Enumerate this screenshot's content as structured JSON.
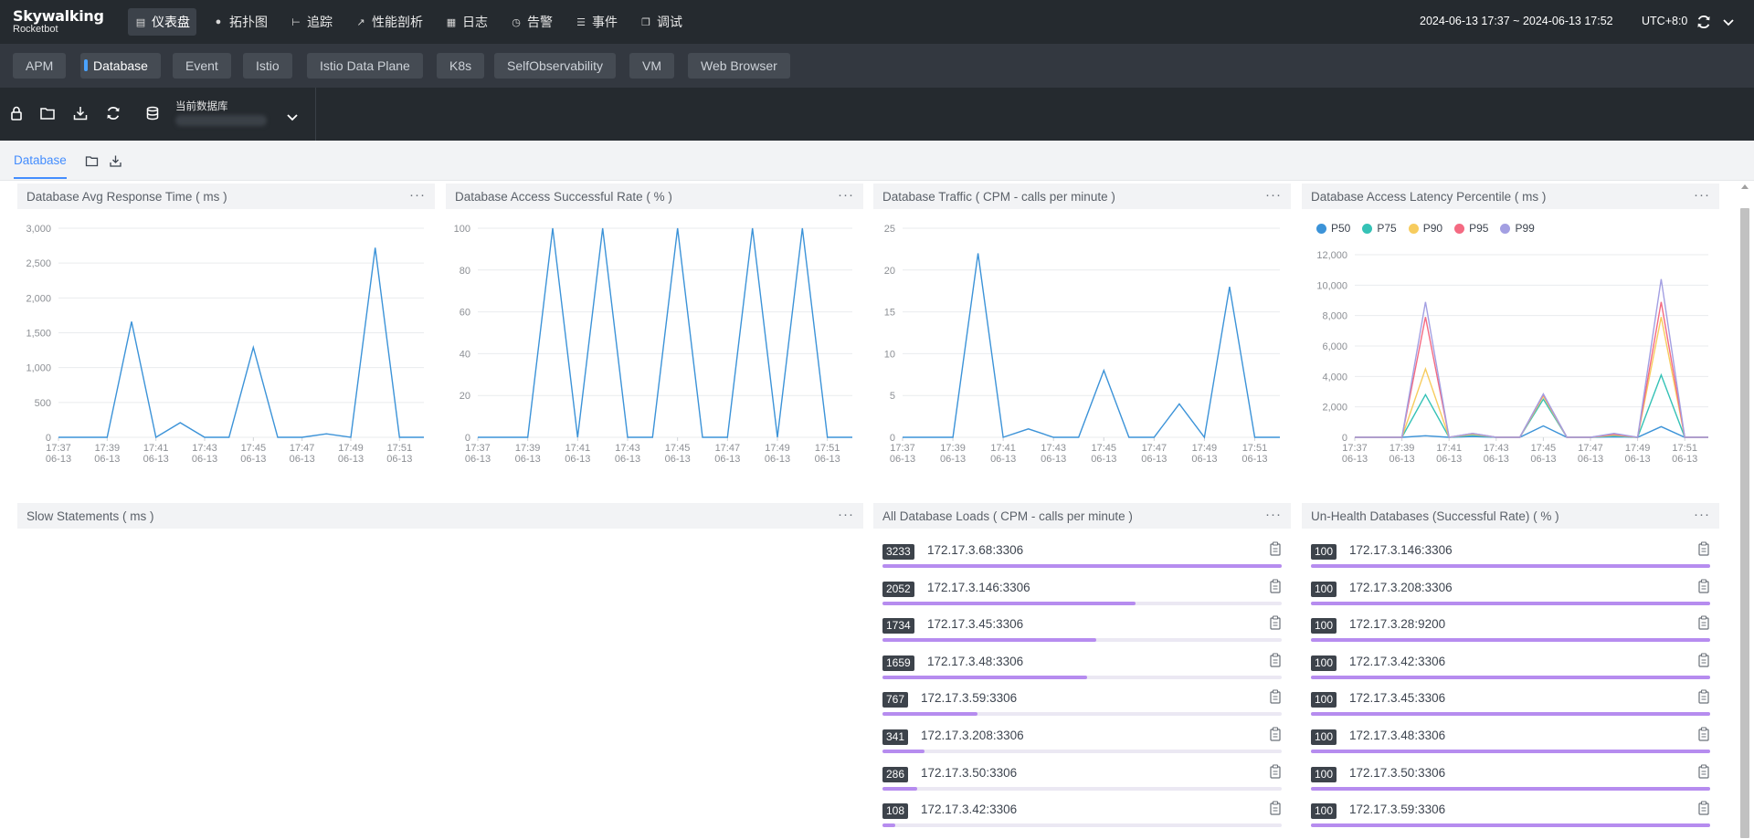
{
  "brand": {
    "name": "Skywalking",
    "sub": "Rocketbot"
  },
  "nav": {
    "items": [
      {
        "icon": "dashboard-icon",
        "label": "仪表盘",
        "active": true
      },
      {
        "icon": "topology-icon",
        "label": "拓扑图",
        "active": false
      },
      {
        "icon": "trace-icon",
        "label": "追踪",
        "active": false
      },
      {
        "icon": "profile-icon",
        "label": "性能剖析",
        "active": false
      },
      {
        "icon": "log-icon",
        "label": "日志",
        "active": false
      },
      {
        "icon": "alarm-icon",
        "label": "告警",
        "active": false
      },
      {
        "icon": "event-icon",
        "label": "事件",
        "active": false
      },
      {
        "icon": "debug-icon",
        "label": "调试",
        "active": false
      }
    ],
    "time_range": "2024-06-13 17:37 ~ 2024-06-13 17:52",
    "timezone": "UTC+8:0"
  },
  "layers": [
    "APM",
    "Database",
    "Event",
    "Istio",
    "Istio Data Plane",
    "K8s",
    "SelfObservability",
    "VM",
    "Web Browser"
  ],
  "active_layer": "Database",
  "toolbar": {
    "selector_label": "当前数据库"
  },
  "dashboard_tab": {
    "label": "Database"
  },
  "x_ticks": [
    [
      "17:37",
      "06-13"
    ],
    [
      "17:39",
      "06-13"
    ],
    [
      "17:41",
      "06-13"
    ],
    [
      "17:43",
      "06-13"
    ],
    [
      "17:45",
      "06-13"
    ],
    [
      "17:47",
      "06-13"
    ],
    [
      "17:49",
      "06-13"
    ],
    [
      "17:51",
      "06-13"
    ]
  ],
  "widgets": {
    "avg_response": {
      "title": "Database Avg Response Time ( ms )"
    },
    "success_rate": {
      "title": "Database Access Successful Rate ( % )"
    },
    "traffic": {
      "title": "Database Traffic ( CPM - calls per minute )"
    },
    "latency": {
      "title": "Database Access Latency Percentile ( ms )"
    },
    "slow_statements": {
      "title": "Slow Statements ( ms )"
    },
    "all_loads": {
      "title": "All Database Loads ( CPM - calls per minute )"
    },
    "unhealthy": {
      "title": "Un-Health Databases (Successful Rate) ( % )"
    }
  },
  "chart_data": [
    {
      "type": "line",
      "title": "Database Avg Response Time ( ms )",
      "x": [
        "17:37",
        "17:38",
        "17:39",
        "17:40",
        "17:41",
        "17:42",
        "17:43",
        "17:44",
        "17:45",
        "17:46",
        "17:47",
        "17:48",
        "17:49",
        "17:50",
        "17:51",
        "17:52"
      ],
      "series": [
        {
          "values": [
            0,
            0,
            0,
            1660,
            0,
            210,
            0,
            0,
            1290,
            0,
            0,
            50,
            0,
            2720,
            0,
            0
          ]
        }
      ],
      "ylim": [
        0,
        3000
      ],
      "yticks": [
        "0",
        "500",
        "1,000",
        "1,500",
        "2,000",
        "2,500",
        "3,000"
      ],
      "color": "#3c93d8"
    },
    {
      "type": "line",
      "title": "Database Access Successful Rate ( % )",
      "x": [
        "17:37",
        "17:38",
        "17:39",
        "17:40",
        "17:41",
        "17:42",
        "17:43",
        "17:44",
        "17:45",
        "17:46",
        "17:47",
        "17:48",
        "17:49",
        "17:50",
        "17:51",
        "17:52"
      ],
      "series": [
        {
          "values": [
            0,
            0,
            0,
            100,
            0,
            100,
            0,
            0,
            100,
            0,
            0,
            100,
            0,
            100,
            0,
            0
          ]
        }
      ],
      "ylim": [
        0,
        100
      ],
      "yticks": [
        "0",
        "20",
        "40",
        "60",
        "80",
        "100"
      ],
      "color": "#3c93d8"
    },
    {
      "type": "line",
      "title": "Database Traffic ( CPM - calls per minute )",
      "x": [
        "17:37",
        "17:38",
        "17:39",
        "17:40",
        "17:41",
        "17:42",
        "17:43",
        "17:44",
        "17:45",
        "17:46",
        "17:47",
        "17:48",
        "17:49",
        "17:50",
        "17:51",
        "17:52"
      ],
      "series": [
        {
          "values": [
            0,
            0,
            0,
            22,
            0,
            1,
            0,
            0,
            8,
            0,
            0,
            4,
            0,
            18,
            0,
            0
          ]
        }
      ],
      "ylim": [
        0,
        25
      ],
      "yticks": [
        "0",
        "5",
        "10",
        "15",
        "20",
        "25"
      ],
      "color": "#3c93d8"
    },
    {
      "type": "line",
      "title": "Database Access Latency Percentile ( ms )",
      "x": [
        "17:37",
        "17:38",
        "17:39",
        "17:40",
        "17:41",
        "17:42",
        "17:43",
        "17:44",
        "17:45",
        "17:46",
        "17:47",
        "17:48",
        "17:49",
        "17:50",
        "17:51",
        "17:52"
      ],
      "series": [
        {
          "name": "P50",
          "color": "#3c93d8",
          "values": [
            0,
            0,
            0,
            100,
            0,
            50,
            0,
            0,
            750,
            0,
            0,
            30,
            0,
            700,
            0,
            0
          ]
        },
        {
          "name": "P75",
          "color": "#35c2b6",
          "values": [
            0,
            0,
            0,
            2800,
            0,
            150,
            0,
            0,
            2500,
            0,
            0,
            100,
            0,
            4100,
            0,
            0
          ]
        },
        {
          "name": "P90",
          "color": "#f7cc5e",
          "values": [
            0,
            0,
            0,
            4500,
            0,
            200,
            0,
            0,
            2700,
            0,
            0,
            150,
            0,
            7900,
            0,
            0
          ]
        },
        {
          "name": "P95",
          "color": "#f46a82",
          "values": [
            0,
            0,
            0,
            7900,
            0,
            250,
            0,
            0,
            2800,
            0,
            0,
            200,
            0,
            8900,
            0,
            0
          ]
        },
        {
          "name": "P99",
          "color": "#a39fe2",
          "values": [
            0,
            0,
            0,
            8900,
            0,
            260,
            0,
            0,
            2850,
            0,
            0,
            260,
            0,
            10400,
            0,
            0
          ]
        }
      ],
      "ylim": [
        0,
        12000
      ],
      "yticks": [
        "0",
        "2,000",
        "4,000",
        "6,000",
        "8,000",
        "10,000",
        "12,000"
      ]
    }
  ],
  "db_loads": [
    {
      "value": "3233",
      "name": "172.17.3.68:3306",
      "fraction": 1.0
    },
    {
      "value": "2052",
      "name": "172.17.3.146:3306",
      "fraction": 0.635
    },
    {
      "value": "1734",
      "name": "172.17.3.45:3306",
      "fraction": 0.536
    },
    {
      "value": "1659",
      "name": "172.17.3.48:3306",
      "fraction": 0.513
    },
    {
      "value": "767",
      "name": "172.17.3.59:3306",
      "fraction": 0.237
    },
    {
      "value": "341",
      "name": "172.17.3.208:3306",
      "fraction": 0.105
    },
    {
      "value": "286",
      "name": "172.17.3.50:3306",
      "fraction": 0.088
    },
    {
      "value": "108",
      "name": "172.17.3.42:3306",
      "fraction": 0.033
    }
  ],
  "unhealthy_dbs": [
    {
      "value": "100",
      "name": "172.17.3.146:3306",
      "fraction": 1.0
    },
    {
      "value": "100",
      "name": "172.17.3.208:3306",
      "fraction": 1.0
    },
    {
      "value": "100",
      "name": "172.17.3.28:9200",
      "fraction": 1.0
    },
    {
      "value": "100",
      "name": "172.17.3.42:3306",
      "fraction": 1.0
    },
    {
      "value": "100",
      "name": "172.17.3.45:3306",
      "fraction": 1.0
    },
    {
      "value": "100",
      "name": "172.17.3.48:3306",
      "fraction": 1.0
    },
    {
      "value": "100",
      "name": "172.17.3.50:3306",
      "fraction": 1.0
    },
    {
      "value": "100",
      "name": "172.17.3.59:3306",
      "fraction": 1.0
    }
  ]
}
